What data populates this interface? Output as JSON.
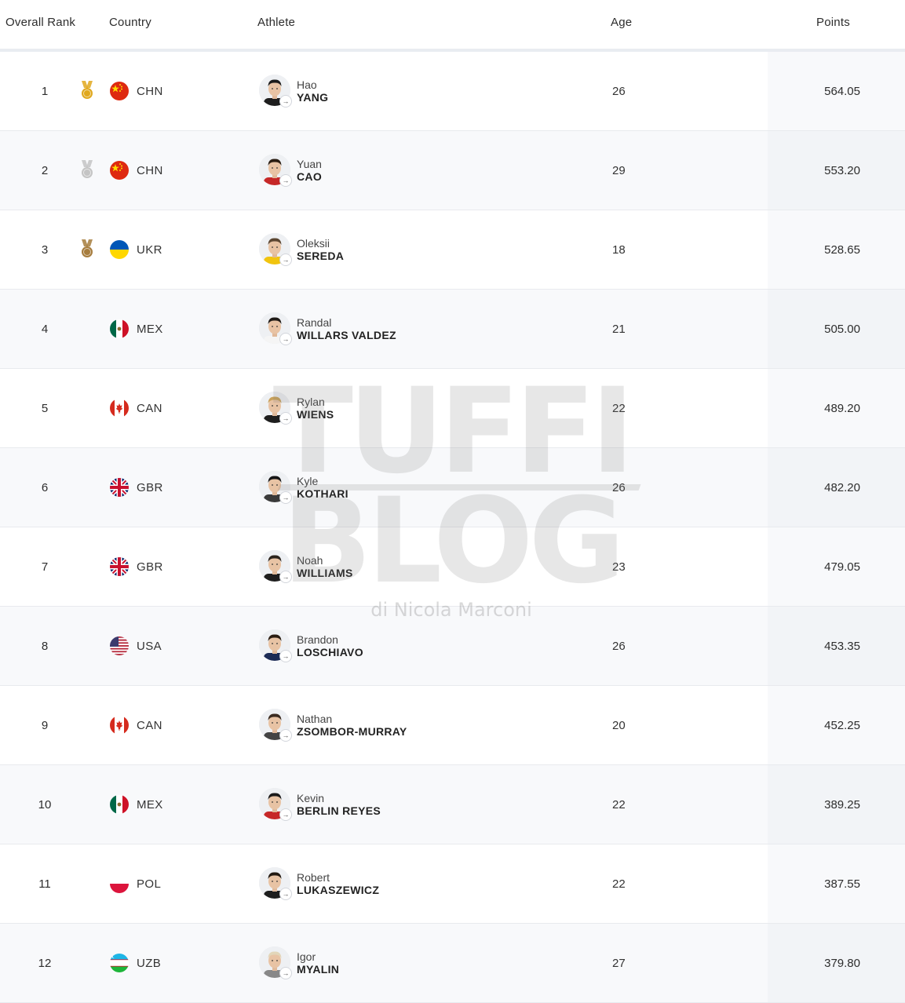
{
  "header": {
    "rank": "Overall Rank",
    "country": "Country",
    "athlete": "Athlete",
    "age": "Age",
    "points": "Points"
  },
  "rows": [
    {
      "rank": "1",
      "medal": "gold",
      "flag": "CHN",
      "code": "CHN",
      "first": "Hao",
      "last": "YANG",
      "age": "26",
      "points": "564.05"
    },
    {
      "rank": "2",
      "medal": "silver",
      "flag": "CHN",
      "code": "CHN",
      "first": "Yuan",
      "last": "CAO",
      "age": "29",
      "points": "553.20"
    },
    {
      "rank": "3",
      "medal": "bronze",
      "flag": "UKR",
      "code": "UKR",
      "first": "Oleksii",
      "last": "SEREDA",
      "age": "18",
      "points": "528.65"
    },
    {
      "rank": "4",
      "medal": "",
      "flag": "MEX",
      "code": "MEX",
      "first": "Randal",
      "last": "WILLARS VALDEZ",
      "age": "21",
      "points": "505.00"
    },
    {
      "rank": "5",
      "medal": "",
      "flag": "CAN",
      "code": "CAN",
      "first": "Rylan",
      "last": "WIENS",
      "age": "22",
      "points": "489.20"
    },
    {
      "rank": "6",
      "medal": "",
      "flag": "GBR",
      "code": "GBR",
      "first": "Kyle",
      "last": "KOTHARI",
      "age": "26",
      "points": "482.20"
    },
    {
      "rank": "7",
      "medal": "",
      "flag": "GBR",
      "code": "GBR",
      "first": "Noah",
      "last": "WILLIAMS",
      "age": "23",
      "points": "479.05"
    },
    {
      "rank": "8",
      "medal": "",
      "flag": "USA",
      "code": "USA",
      "first": "Brandon",
      "last": "LOSCHIAVO",
      "age": "26",
      "points": "453.35"
    },
    {
      "rank": "9",
      "medal": "",
      "flag": "CAN",
      "code": "CAN",
      "first": "Nathan",
      "last": "ZSOMBOR-MURRAY",
      "age": "20",
      "points": "452.25"
    },
    {
      "rank": "10",
      "medal": "",
      "flag": "MEX",
      "code": "MEX",
      "first": "Kevin",
      "last": "BERLIN REYES",
      "age": "22",
      "points": "389.25"
    },
    {
      "rank": "11",
      "medal": "",
      "flag": "POL",
      "code": "POL",
      "first": "Robert",
      "last": "LUKASZEWICZ",
      "age": "22",
      "points": "387.55"
    },
    {
      "rank": "12",
      "medal": "",
      "flag": "UZB",
      "code": "UZB",
      "first": "Igor",
      "last": "MYALIN",
      "age": "27",
      "points": "379.80"
    }
  ],
  "colors": {
    "gold": "#e0a81e",
    "silver": "#c4c4c4",
    "bronze": "#a67c3d"
  },
  "icons": {
    "medal": "medal-icon",
    "avatar_badge": "arrow-right-icon"
  },
  "watermark": {
    "line1": "TUFFI",
    "line2": "BLOG",
    "sub": "di Nicola Marconi"
  }
}
